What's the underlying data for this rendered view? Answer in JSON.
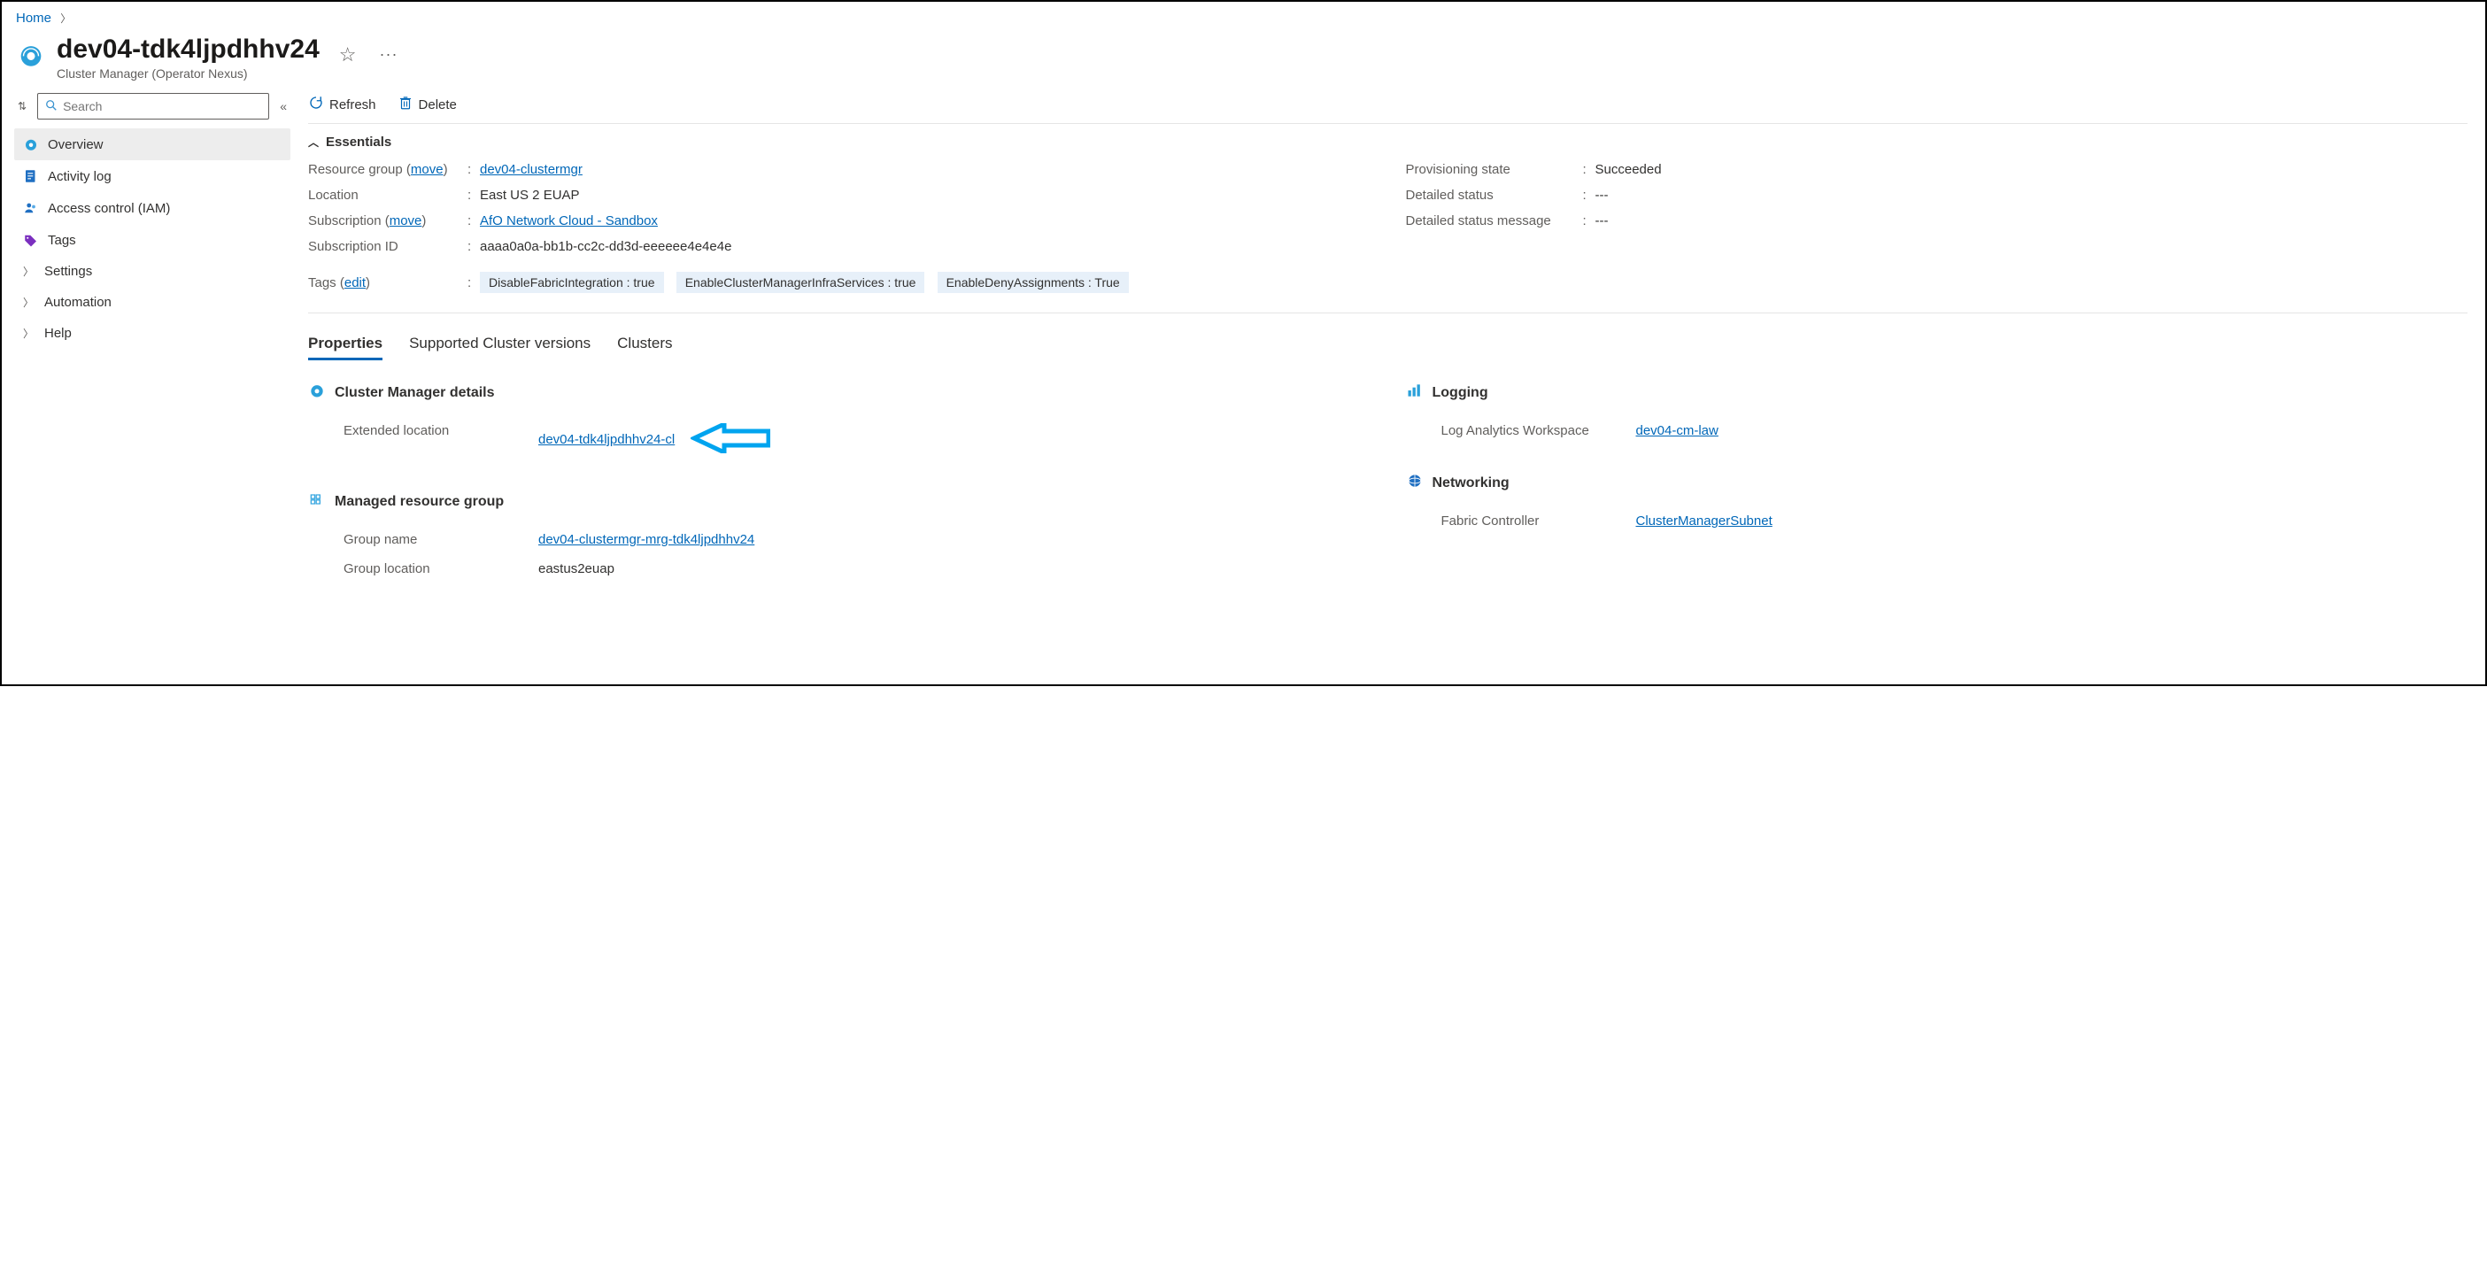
{
  "breadcrumb": {
    "home": "Home"
  },
  "header": {
    "title": "dev04-tdk4ljpdhhv24",
    "subtitle": "Cluster Manager (Operator Nexus)"
  },
  "sidebar": {
    "search_placeholder": "Search",
    "items": {
      "overview": "Overview",
      "activity": "Activity log",
      "iam": "Access control (IAM)",
      "tags": "Tags",
      "settings": "Settings",
      "automation": "Automation",
      "help": "Help"
    }
  },
  "toolbar": {
    "refresh": "Refresh",
    "delete": "Delete"
  },
  "essentials": {
    "heading": "Essentials",
    "left": {
      "rg_label": "Resource group (",
      "rg_move": "move",
      "rg_close": ")",
      "rg_value": "dev04-clustermgr",
      "loc_label": "Location",
      "loc_value": "East US 2 EUAP",
      "sub_label": "Subscription (",
      "sub_move": "move",
      "sub_close": ")",
      "sub_value": "AfO Network Cloud - Sandbox",
      "subid_label": "Subscription ID",
      "subid_value": "aaaa0a0a-bb1b-cc2c-dd3d-eeeeee4e4e4e",
      "tags_label": "Tags (",
      "tags_edit": "edit",
      "tags_close": ")",
      "tag1": "DisableFabricIntegration : true",
      "tag2": "EnableClusterManagerInfraServices : true",
      "tag3": "EnableDenyAssignments : True"
    },
    "right": {
      "prov_label": "Provisioning state",
      "prov_value": "Succeeded",
      "dstatus_label": "Detailed status",
      "dstatus_value": "---",
      "dmsg_label": "Detailed status message",
      "dmsg_value": "---"
    }
  },
  "tabs": {
    "properties": "Properties",
    "versions": "Supported Cluster versions",
    "clusters": "Clusters"
  },
  "props": {
    "cm": {
      "heading": "Cluster Manager details",
      "extloc_label": "Extended location",
      "extloc_value": "dev04-tdk4ljpdhhv24-cl"
    },
    "mrg": {
      "heading": "Managed resource group",
      "name_label": "Group name",
      "name_value": "dev04-clustermgr-mrg-tdk4ljpdhhv24",
      "loc_label": "Group location",
      "loc_value": "eastus2euap"
    },
    "log": {
      "heading": "Logging",
      "law_label": "Log Analytics Workspace",
      "law_value": "dev04-cm-law"
    },
    "net": {
      "heading": "Networking",
      "fc_label": "Fabric Controller",
      "fc_value": "ClusterManagerSubnet"
    }
  }
}
